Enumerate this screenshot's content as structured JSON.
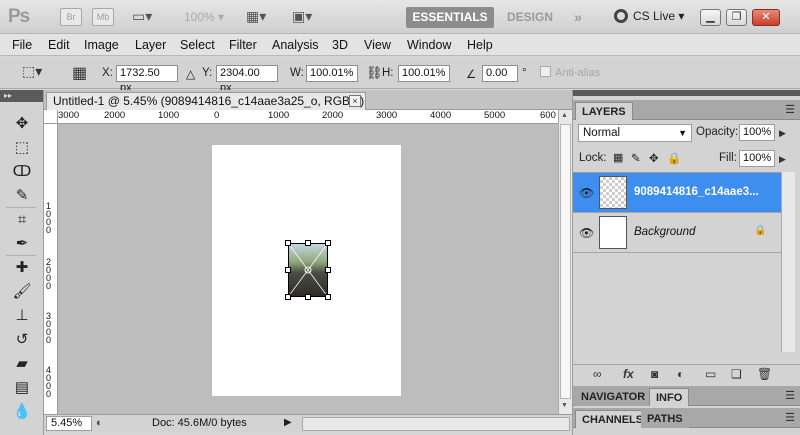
{
  "appbar": {
    "logo": "Ps",
    "bridge": "Br",
    "minibridge": "Mb",
    "zoom": "100%",
    "workspace_active": "ESSENTIALS",
    "workspace_other": "DESIGN",
    "workspace_more": "»",
    "cslive": "CS Live",
    "win_minimize": "▁",
    "win_restore": "❐",
    "win_close": "✕"
  },
  "menu": [
    "File",
    "Edit",
    "Image",
    "Layer",
    "Select",
    "Filter",
    "Analysis",
    "3D",
    "View",
    "Window",
    "Help"
  ],
  "options": {
    "x_label": "X:",
    "x_value": "1732.50 px",
    "y_label": "Y:",
    "y_value": "2304.00 px",
    "w_label": "W:",
    "w_value": "100.01%",
    "h_label": "H:",
    "h_value": "100.01%",
    "angle_value": "0.00",
    "angle_unit": "°",
    "antialias": "Anti-alias"
  },
  "document": {
    "tab_title": "Untitled-1 @ 5.45% (9089414816_c14aae3a25_o, RGB/8)",
    "tab_close": "×",
    "hruler_labels": [
      "3000",
      "2000",
      "1000",
      "0",
      "1000",
      "2000",
      "3000",
      "4000",
      "5000",
      "600"
    ],
    "vruler_labels": [
      "1000",
      "2000",
      "3000",
      "4000"
    ]
  },
  "status": {
    "zoom": "5.45%",
    "doc": "Doc: 45.6M/0 bytes",
    "arrow": "▶"
  },
  "layers_panel": {
    "tab_layers": "LAYERS",
    "menu_icon": "☰",
    "blend_mode": "Normal",
    "opacity_label": "Opacity:",
    "opacity_value": "100%",
    "lock_label": "Lock:",
    "fill_label": "Fill:",
    "fill_value": "100%",
    "layers": [
      {
        "name": "9089414816_c14aae3...",
        "selected": true
      },
      {
        "name": "Background",
        "selected": false
      }
    ]
  },
  "bottom_panels": {
    "tab_navigator": "NAVIGATOR",
    "tab_info": "INFO",
    "tab_channels": "CHANNELS",
    "tab_paths": "PATHS"
  },
  "colors": {
    "accent_selected": "#3d8eef",
    "workspace_active_bg": "#8c8c8c",
    "close_button": "#c63f2a"
  }
}
